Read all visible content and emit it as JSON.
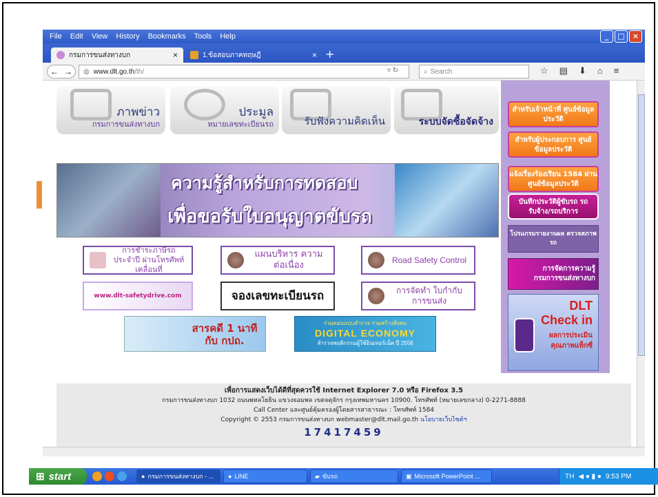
{
  "browser": {
    "menu": [
      "File",
      "Edit",
      "View",
      "History",
      "Bookmarks",
      "Tools",
      "Help"
    ],
    "tabs": [
      {
        "title": "กรมการขนส่งทางบก",
        "close": "×"
      },
      {
        "title": "1.ข้อสอบภาคทฤษฎี",
        "close": "×"
      }
    ],
    "new_tab": "+",
    "url_host": "www.dlt.go.th",
    "url_path": "/th/",
    "search_placeholder": "Search",
    "back": "←",
    "forward": "→"
  },
  "page": {
    "top_tiles": [
      {
        "line1": "ภาพข่าว",
        "line2": "กรมการขนส่งทางบก"
      },
      {
        "line1": "ประมูล",
        "line2": "หมายเลขทะเบียนรถ"
      },
      {
        "line1": "รับฟังความคิดเห็น",
        "line2": ""
      },
      {
        "line1": "ระบบจัดซื้อจัดจ้าง",
        "line2": ""
      }
    ],
    "banner": {
      "line1": "ความรู้สำหรับการทดสอบ",
      "line2": "เพื่อขอรับใบอนุญาตขับรถ"
    },
    "promo_buttons": [
      {
        "text": "การชำระภาษีรถประจำปี ผ่านโทรศัพท์เคลื่อนที่"
      },
      {
        "text": "แผนบริหาร ความต่อเนื่อง"
      },
      {
        "text": "Road Safety Control"
      },
      {
        "text": "www.dlt-safetydrive.com"
      },
      {
        "text": "จองเลขทะเบียนรถ"
      },
      {
        "text": "การจัดทำ ใบกำกับการขนส่ง"
      }
    ],
    "pictures": [
      {
        "text": "สารคดี 1 นาที กับ กปถ."
      },
      {
        "top": "ร่วมตอบแบบสำรวจ ร่วมสร้างสังคม",
        "main": "DIGITAL ECONOMY",
        "bottom": "สำรวจพฤติกรรมผู้ใช้อินเทอร์เน็ต ปี 2558"
      }
    ],
    "sidebar": [
      {
        "text": "สำหรับเจ้าหน้าที่ ศูนย์ข้อมูลประวัติ"
      },
      {
        "text": "สำหรับผู้ประกอบการ ศูนย์ข้อมูลประวัติ"
      },
      {
        "text": "แจ้งเรื่องร้องเรียน 1584 ผ่านศูนย์ข้อมูลประวัติ"
      },
      {
        "text": "บันทึกประวัติผู้ขับรถ รถรับจ้าง/รถบริการ"
      },
      {
        "text": "โปรแกรมรายงานผล ตรวจสภาพรถ"
      },
      {
        "text": "การจัดการความรู้ กรมการขนส่งทางบก"
      },
      {
        "line1": "DLT",
        "line2": "Check in",
        "line3": "ผลการประเมิน",
        "line4": "คุณภาพแท็กซี่"
      }
    ],
    "footer": {
      "line1": "เพื่อการแสดงเว็บได้ดีที่สุดควรใช้ Internet Explorer 7.0 หรือ Firefox 3.5",
      "line2": "กรมการขนส่งทางบก 1032 ถนนพหลโยธิน แขวงจอมพล เขตจตุจักร กรุงเทพมหานคร 10900. โทรศัพท์ (หมายเลขกลาง) 0-2271-8888",
      "line3": "Call Center และศูนย์คุ้มครองผู้โดยสารสาธารณะ : โทรศัพท์ 1584",
      "line4_pre": "Copyright © 2553 กรมการขนส่งทางบก webmaster@dlt.mail.go.th",
      "link": "นโยบายเว็บไซต์ฯ",
      "counter": "17417459"
    }
  },
  "taskbar": {
    "start": "start",
    "tasks": [
      "กรมการขนส่งทางบก - ...",
      "LINE",
      "ขับรถ",
      "Microsoft PowerPoint ..."
    ],
    "lang": "TH",
    "time": "9:53 PM"
  },
  "colors": {
    "accent_purple": "#b9a2d9",
    "orange": "#f07818",
    "xp_blue": "#245ad0"
  }
}
